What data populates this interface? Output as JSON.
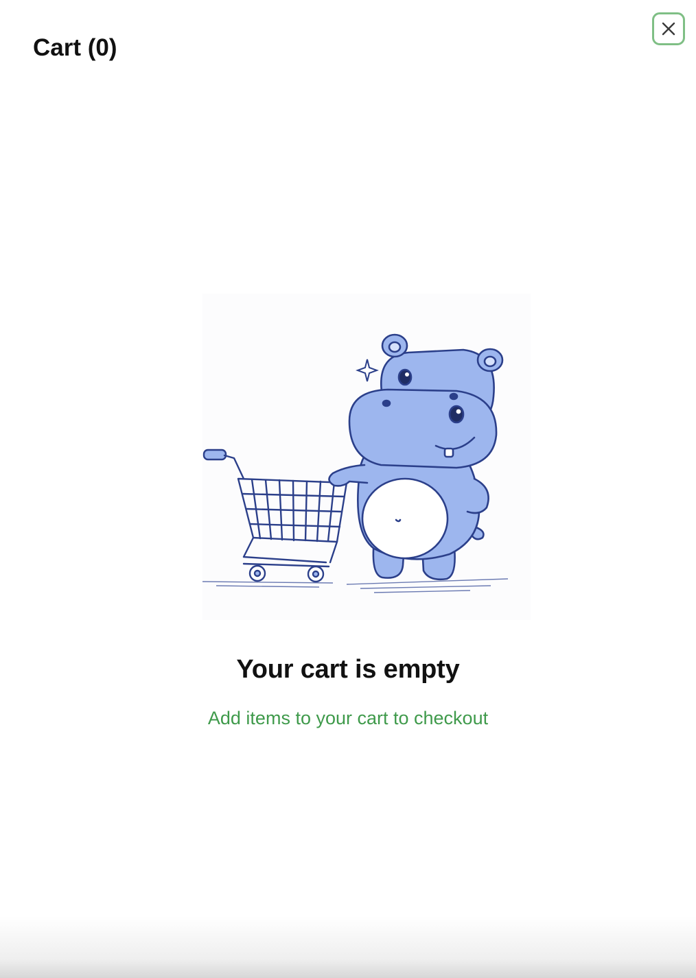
{
  "header": {
    "title": "Cart (0)",
    "close_icon": "close-icon"
  },
  "empty_state": {
    "illustration": "hippo-with-shopping-cart-illustration",
    "heading": "Your cart is empty",
    "subtext": "Add items to your cart to checkout"
  },
  "colors": {
    "accent": "#3f9a4b",
    "close_border": "#7fbf85",
    "hippo_fill": "#9db6ee",
    "line_ink": "#2b3f8a"
  }
}
